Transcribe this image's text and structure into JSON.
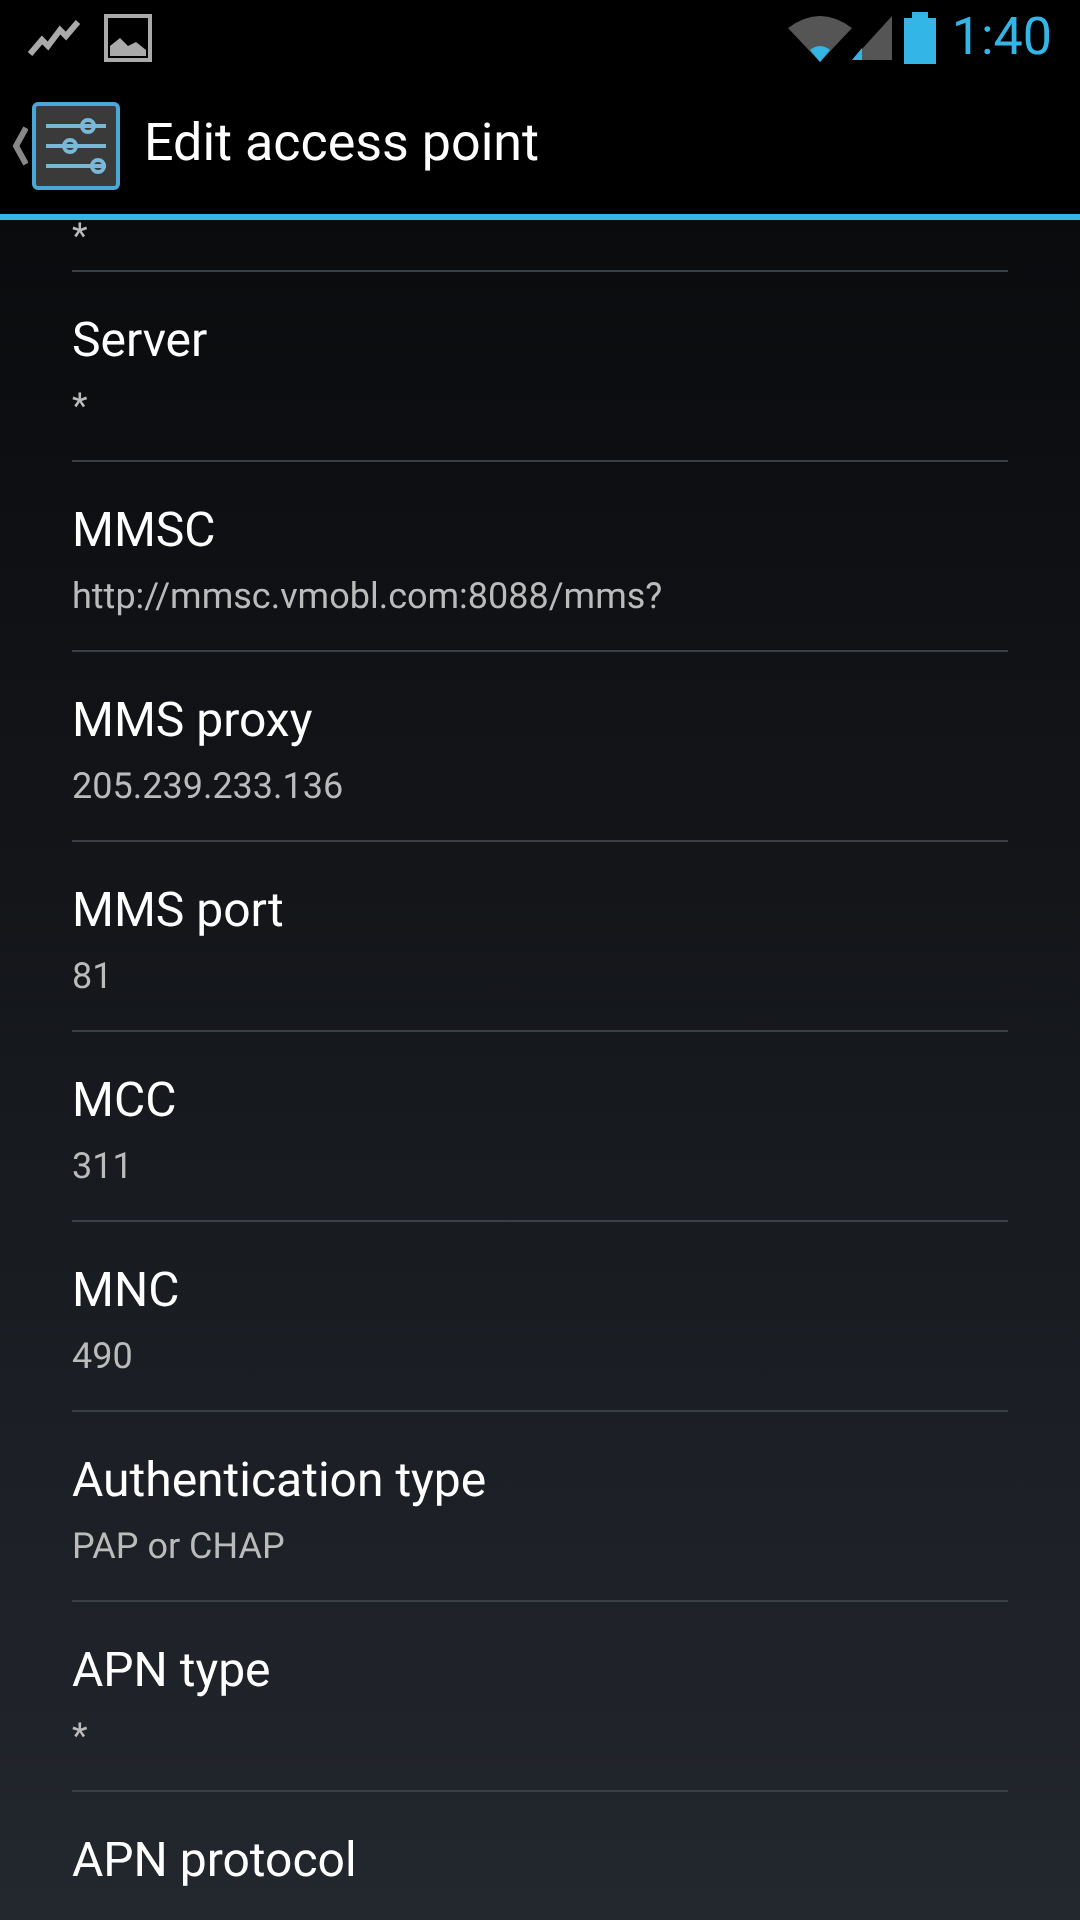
{
  "status_bar": {
    "time": "1:40"
  },
  "action_bar": {
    "title": "Edit access point"
  },
  "top_partial_value": "*",
  "preferences": [
    {
      "title": "Server",
      "value": "*"
    },
    {
      "title": "MMSC",
      "value": "http://mmsc.vmobl.com:8088/mms?"
    },
    {
      "title": "MMS proxy",
      "value": "205.239.233.136"
    },
    {
      "title": "MMS port",
      "value": "81"
    },
    {
      "title": "MCC",
      "value": "311"
    },
    {
      "title": "MNC",
      "value": "490"
    },
    {
      "title": "Authentication type",
      "value": "PAP or CHAP"
    },
    {
      "title": "APN type",
      "value": "*"
    },
    {
      "title": "APN protocol"
    }
  ]
}
